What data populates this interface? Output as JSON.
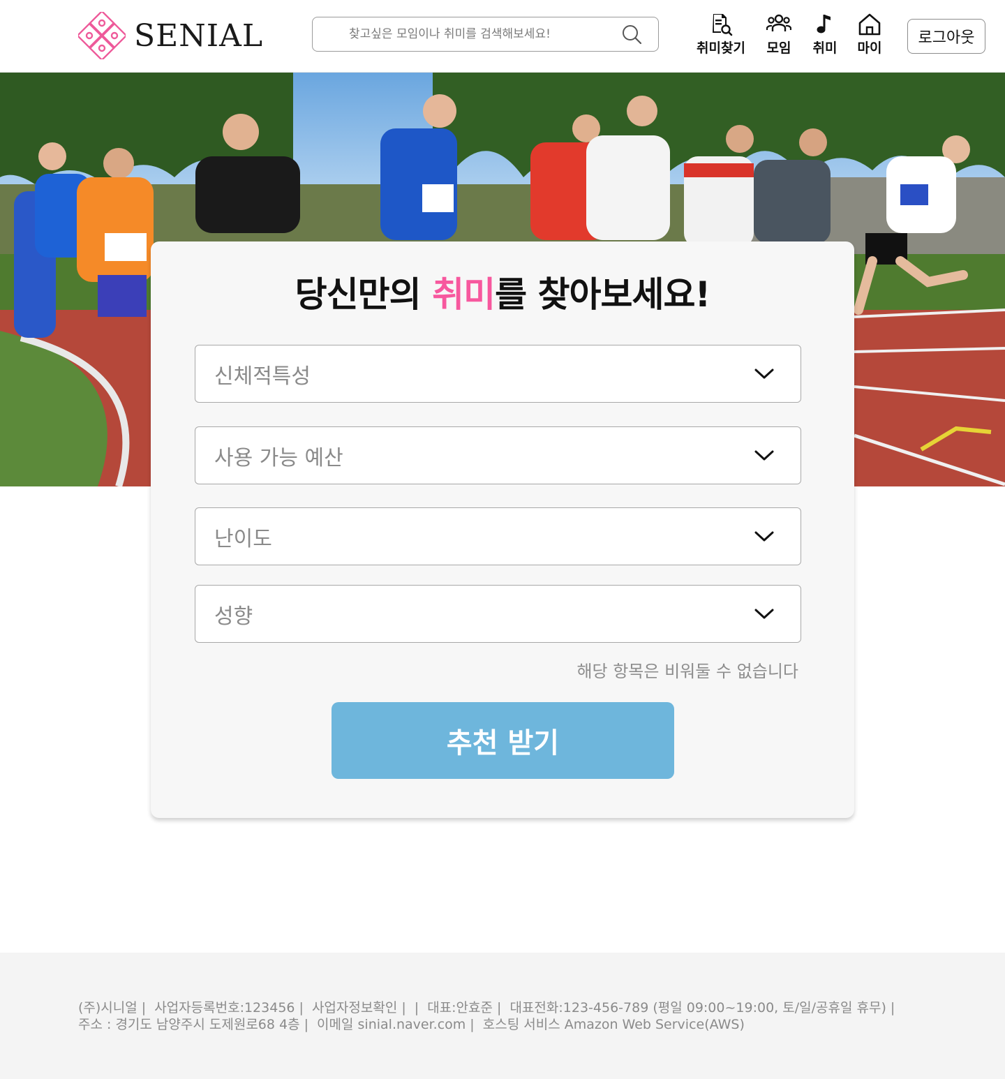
{
  "header": {
    "logo_text": "SENIAL",
    "search_placeholder": "찾고싶은 모임이나 취미를 검색해보세요!",
    "nav": [
      {
        "label": "취미찾기",
        "icon": "search-document-icon"
      },
      {
        "label": "모임",
        "icon": "group-icon"
      },
      {
        "label": "취미",
        "icon": "music-note-icon"
      },
      {
        "label": "마이",
        "icon": "home-icon"
      }
    ],
    "logout_label": "로그아웃"
  },
  "hero": {
    "image": "running-race-photo"
  },
  "card": {
    "title_before": "당신만의 ",
    "title_accent": "취미",
    "title_after": "를 찾아보세요!",
    "selects": [
      {
        "label": "신체적특성"
      },
      {
        "label": "사용 가능 예산"
      },
      {
        "label": "난이도"
      },
      {
        "label": "성향"
      }
    ],
    "note": "해당 항목은 비워둘 수 없습니다",
    "submit_label": "추천 받기"
  },
  "footer": {
    "line1": [
      "(주)시니얼",
      "사업자등록번호:123456",
      "사업자정보확인",
      "",
      "대표:안효준",
      "대표전화:123-456-789 (평일 09:00~19:00, 토/일/공휴일 휴무)",
      ""
    ],
    "line2": [
      "주소 : 경기도 남양주시 도제원로68 4층",
      "이메일 sinial.naver.com",
      "호스팅 서비스  Amazon Web Service(AWS)"
    ]
  },
  "colors": {
    "accent_pink": "#f7589e",
    "button_blue": "#6eb6dc",
    "card_bg": "#f7f7f7",
    "footer_bg": "#f4f4f4"
  }
}
